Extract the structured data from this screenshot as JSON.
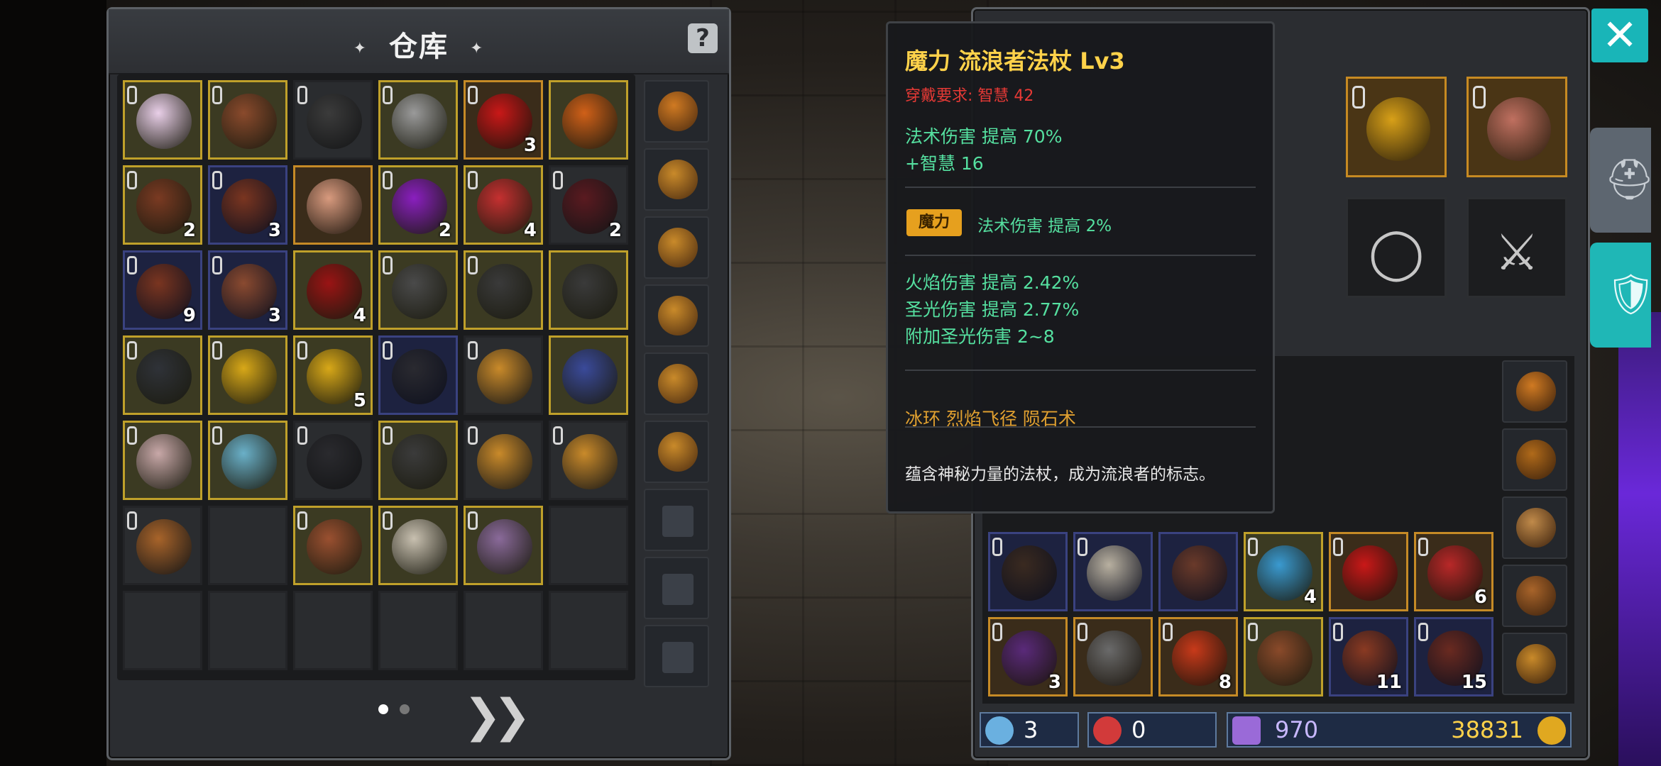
{
  "warehouse": {
    "title": "仓库",
    "title_deco": "✦",
    "help": "?",
    "pager_dots": 2,
    "active_page": 1,
    "next_label": "»"
  },
  "warehouse_grid": [
    {
      "type": "gold",
      "locked": true,
      "item": "girl-face",
      "color": "#e9cfe8",
      "count": ""
    },
    {
      "type": "gold",
      "locked": true,
      "item": "staff",
      "color": "#8a4a2c",
      "count": ""
    },
    {
      "type": "empty",
      "locked": true,
      "item": "gauntlet",
      "color": "#3b3b3b",
      "count": ""
    },
    {
      "type": "gold",
      "locked": true,
      "item": "axe",
      "color": "#9a9a9a",
      "count": ""
    },
    {
      "type": "orange",
      "locked": true,
      "item": "red-crystal",
      "color": "#c91818",
      "count": "3"
    },
    {
      "type": "gold",
      "locked": false,
      "item": "amulet",
      "color": "#d06018",
      "count": ""
    },
    {
      "type": "gold",
      "locked": true,
      "item": "claw",
      "color": "#7a3a22",
      "count": "2"
    },
    {
      "type": "blue",
      "locked": true,
      "item": "hide",
      "color": "#7a3520",
      "count": "3"
    },
    {
      "type": "orange",
      "locked": false,
      "item": "doll",
      "color": "#d89a7e",
      "count": ""
    },
    {
      "type": "gold",
      "locked": true,
      "item": "purple-orb",
      "color": "#8a1fbf",
      "count": "2"
    },
    {
      "type": "gold",
      "locked": true,
      "item": "mech-head",
      "color": "#c53030",
      "count": "4"
    },
    {
      "type": "empty",
      "locked": true,
      "item": "spikes",
      "color": "#5a1a20",
      "count": "2"
    },
    {
      "type": "blue",
      "locked": true,
      "item": "leaf",
      "color": "#7a3520",
      "count": "9"
    },
    {
      "type": "blue",
      "locked": true,
      "item": "hide",
      "color": "#8a4a30",
      "count": "3"
    },
    {
      "type": "gold",
      "locked": false,
      "item": "red-rose",
      "color": "#9a1414",
      "count": "4"
    },
    {
      "type": "gold",
      "locked": true,
      "item": "dagger",
      "color": "#4a4a4a",
      "count": ""
    },
    {
      "type": "gold",
      "locked": true,
      "item": "bow",
      "color": "#3a3a3a",
      "count": ""
    },
    {
      "type": "gold",
      "locked": false,
      "item": "bow",
      "color": "#3a3a3a",
      "count": ""
    },
    {
      "type": "gold",
      "locked": true,
      "item": "boots",
      "color": "#2f3238",
      "count": ""
    },
    {
      "type": "gold",
      "locked": true,
      "item": "scroll",
      "color": "#d8a818",
      "count": ""
    },
    {
      "type": "gold",
      "locked": true,
      "item": "scroll",
      "color": "#d8a818",
      "count": "5"
    },
    {
      "type": "blue",
      "locked": true,
      "item": "blade",
      "color": "#2a2a30",
      "count": ""
    },
    {
      "type": "empty",
      "locked": true,
      "item": "pouch",
      "color": "#c98a2a",
      "count": ""
    },
    {
      "type": "gold",
      "locked": false,
      "item": "helmet-blue",
      "color": "#3a4a9a",
      "count": ""
    },
    {
      "type": "gold",
      "locked": true,
      "item": "masked-girl",
      "color": "#c8a8a8",
      "count": ""
    },
    {
      "type": "gold",
      "locked": true,
      "item": "spirit",
      "color": "#6ab0c8",
      "count": ""
    },
    {
      "type": "empty",
      "locked": true,
      "item": "helm",
      "color": "#2a2a2e",
      "count": ""
    },
    {
      "type": "gold",
      "locked": true,
      "item": "gauntlet",
      "color": "#3b3b3b",
      "count": ""
    },
    {
      "type": "empty",
      "locked": true,
      "item": "pouch",
      "color": "#c98a2a",
      "count": ""
    },
    {
      "type": "empty",
      "locked": true,
      "item": "pouch",
      "color": "#c98a2a",
      "count": ""
    },
    {
      "type": "empty",
      "locked": true,
      "item": "sack",
      "color": "#a8642a",
      "count": ""
    },
    {
      "type": "empty",
      "locked": false,
      "item": "",
      "color": "",
      "count": ""
    },
    {
      "type": "gold",
      "locked": true,
      "item": "staff",
      "color": "#9a5030",
      "count": ""
    },
    {
      "type": "gold",
      "locked": true,
      "item": "great-helm",
      "color": "#c8c0b0",
      "count": ""
    },
    {
      "type": "gold",
      "locked": true,
      "item": "axe",
      "color": "#8a6a9a",
      "count": ""
    },
    {
      "type": "empty",
      "locked": false,
      "item": "",
      "color": "",
      "count": ""
    },
    {
      "type": "empty",
      "locked": false,
      "item": "",
      "color": "",
      "count": ""
    },
    {
      "type": "empty",
      "locked": false,
      "item": "",
      "color": "",
      "count": ""
    },
    {
      "type": "empty",
      "locked": false,
      "item": "",
      "color": "",
      "count": ""
    },
    {
      "type": "empty",
      "locked": false,
      "item": "",
      "color": "",
      "count": ""
    },
    {
      "type": "empty",
      "locked": false,
      "item": "",
      "color": "",
      "count": ""
    },
    {
      "type": "empty",
      "locked": false,
      "item": "",
      "color": "",
      "count": ""
    }
  ],
  "warehouse_side": [
    {
      "kind": "bag",
      "color": "#d07a22"
    },
    {
      "kind": "pouch",
      "color": "#c98a2a"
    },
    {
      "kind": "pouch",
      "color": "#c98a2a"
    },
    {
      "kind": "pouch",
      "color": "#c98a2a"
    },
    {
      "kind": "pouch",
      "color": "#c98a2a"
    },
    {
      "kind": "pouch",
      "color": "#c98a2a"
    },
    {
      "kind": "add",
      "color": ""
    },
    {
      "kind": "add",
      "color": ""
    },
    {
      "kind": "add",
      "color": ""
    }
  ],
  "tooltip": {
    "title": "魔力 流浪者法杖 Lv3",
    "req": "穿戴要求:  智慧 42",
    "line1": "法术伤害 提高 70%",
    "line2": "+智慧 16",
    "badge": "魔力",
    "badge_line": "法术伤害 提高 2%",
    "line3": "火焰伤害 提高 2.42%",
    "line4": "圣光伤害 提高 2.77%",
    "line5": "附加圣光伤害 2~8",
    "skills": "冰环   烈焰飞径   陨石术",
    "desc": "蕴含神秘力量的法杖，成为流浪者的标志。"
  },
  "equipment": [
    {
      "type": "orange",
      "locked": true,
      "item": "ring",
      "color": "#d8a018"
    },
    {
      "type": "orange",
      "locked": true,
      "item": "staff",
      "color": "#c07060"
    },
    {
      "type": "empty",
      "locked": false,
      "item": "ring-slot",
      "glyph": "◯"
    },
    {
      "type": "empty",
      "locked": false,
      "item": "sword-slot",
      "glyph": "⚔"
    }
  ],
  "inventory_rows": [
    [
      {
        "type": "blue",
        "locked": true,
        "item": "boots",
        "color": "#3a2a20",
        "count": ""
      },
      {
        "type": "blue",
        "locked": true,
        "item": "axe",
        "color": "#b8b0a0",
        "count": ""
      },
      {
        "type": "blue",
        "locked": false,
        "item": "armor",
        "color": "#6a3a2a",
        "count": ""
      },
      {
        "type": "gold",
        "locked": true,
        "item": "scroll",
        "color": "#3a9ad0",
        "count": "4"
      },
      {
        "type": "orange",
        "locked": true,
        "item": "red-crystal",
        "color": "#c91818",
        "count": ""
      },
      {
        "type": "orange",
        "locked": true,
        "item": "red-ore",
        "color": "#b82828",
        "count": "6"
      }
    ],
    [
      {
        "type": "orange",
        "locked": true,
        "item": "purple-gem",
        "color": "#5a2a7a",
        "count": "3"
      },
      {
        "type": "orange",
        "locked": true,
        "item": "ore",
        "color": "#6a6a6a",
        "count": ""
      },
      {
        "type": "orange",
        "locked": true,
        "item": "swirl",
        "color": "#c83a1a",
        "count": "8"
      },
      {
        "type": "gold",
        "locked": true,
        "item": "claw",
        "color": "#8a4a2a",
        "count": ""
      },
      {
        "type": "blue",
        "locked": true,
        "item": "hide",
        "color": "#8a3a22",
        "count": "11"
      },
      {
        "type": "blue",
        "locked": true,
        "item": "horn",
        "color": "#6a2a20",
        "count": "15"
      }
    ]
  ],
  "inventory_upper": [
    {
      "type": "orange",
      "locked": false,
      "item": "purple-knight",
      "color": "#6a4a8a"
    },
    {
      "type": "gold",
      "locked": true,
      "item": "chest-plate",
      "color": "#6a6a6a"
    },
    {
      "type": "gold",
      "locked": true,
      "item": "red-armor",
      "color": "#8a2a20"
    },
    {
      "type": "blue",
      "locked": true,
      "item": "glove",
      "color": "#8a8a8a"
    },
    {
      "type": "blue",
      "locked": true,
      "item": "glove",
      "color": "#3a3a3a"
    }
  ],
  "bag_col": [
    {
      "color": "#d07a22"
    },
    {
      "color": "#b06a1a"
    },
    {
      "color": "#c08a4a"
    },
    {
      "color": "#a8642a"
    },
    {
      "color": "#c98a2a"
    }
  ],
  "status": {
    "sp": "3",
    "hp": "0",
    "gems": "970",
    "gold": "38831"
  },
  "colors": {
    "tab_active": "#1fb7b6",
    "tab_inactive": "#5d6670",
    "close": "#19b5b8"
  }
}
